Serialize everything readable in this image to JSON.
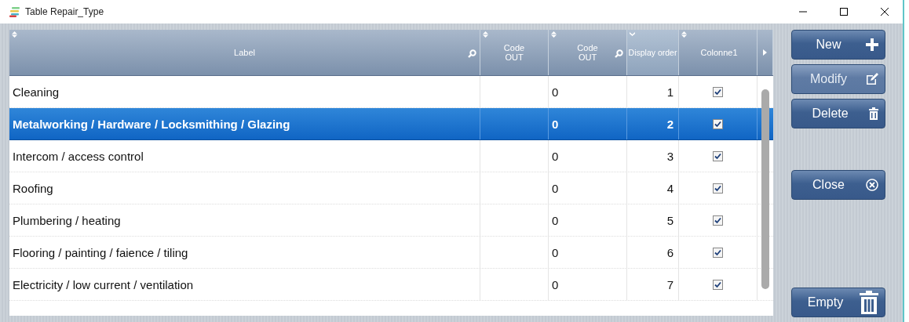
{
  "window": {
    "title": "Table Repair_Type"
  },
  "table": {
    "columns": [
      {
        "label": "Label",
        "search": true,
        "sorted": false
      },
      {
        "label": "Code OUT",
        "search": false,
        "sorted": false
      },
      {
        "label": "Code OUT",
        "search": true,
        "sorted": false
      },
      {
        "label": "Display order",
        "search": false,
        "sorted": true
      },
      {
        "label": "Colonne1",
        "search": false,
        "sorted": false
      }
    ],
    "rows": [
      {
        "label": "Cleaning",
        "code_out_2": "0",
        "display_order": "1",
        "colonne1": true,
        "selected": false
      },
      {
        "label": "Metalworking / Hardware / Locksmithing / Glazing",
        "code_out_2": "0",
        "display_order": "2",
        "colonne1": true,
        "selected": true
      },
      {
        "label": "Intercom / access control",
        "code_out_2": "0",
        "display_order": "3",
        "colonne1": true,
        "selected": false
      },
      {
        "label": "Roofing",
        "code_out_2": "0",
        "display_order": "4",
        "colonne1": true,
        "selected": false
      },
      {
        "label": "Plumbering / heating",
        "code_out_2": "0",
        "display_order": "5",
        "colonne1": true,
        "selected": false
      },
      {
        "label": "Flooring / painting / faience / tiling",
        "code_out_2": "0",
        "display_order": "6",
        "colonne1": true,
        "selected": false
      },
      {
        "label": "Electricity / low current / ventilation",
        "code_out_2": "0",
        "display_order": "7",
        "colonne1": true,
        "selected": false
      }
    ]
  },
  "buttons": [
    {
      "label": "New",
      "kind": "new",
      "disabled": false
    },
    {
      "label": "Modify",
      "kind": "modify",
      "disabled": true
    },
    {
      "label": "Delete",
      "kind": "delete",
      "disabled": false
    },
    {
      "label": "Close",
      "kind": "close",
      "disabled": false
    },
    {
      "label": "Empty",
      "kind": "empty",
      "disabled": false
    }
  ]
}
